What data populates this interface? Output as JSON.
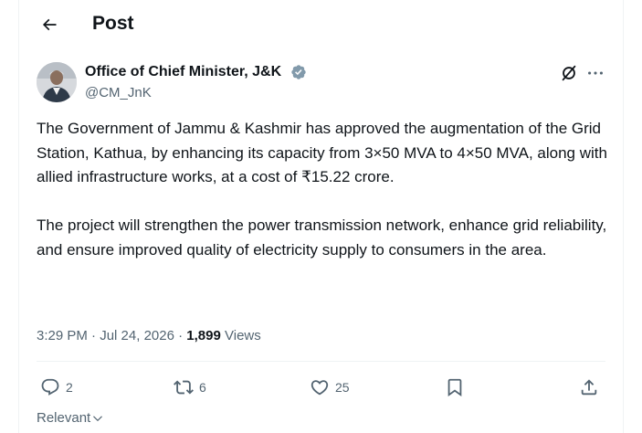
{
  "header": {
    "title": "Post",
    "back_icon": "arrow-left-icon"
  },
  "author": {
    "name": "Office of Chief Minister, J&K",
    "handle": "@CM_JnK",
    "verified_color": "#829aab"
  },
  "tweet": {
    "paragraphs": [
      "The Government of Jammu & Kashmir has approved the augmentation of the Grid Station, Kathua, by enhancing its capacity from 3×50 MVA to 4×50 MVA, along with allied infrastructure works, at a cost of ₹15.22 crore.",
      "The project will strengthen the power transmission network, enhance grid reliability, and ensure improved quality of electricity supply to consumers in the area."
    ]
  },
  "meta": {
    "time": "3:29 PM",
    "separator": "·",
    "date": "Jul 24, 2026",
    "views_count": "1,899",
    "views_label": "Views"
  },
  "actions": {
    "replies": "2",
    "reposts": "6",
    "likes": "25"
  },
  "sort": {
    "label": "Relevant"
  }
}
